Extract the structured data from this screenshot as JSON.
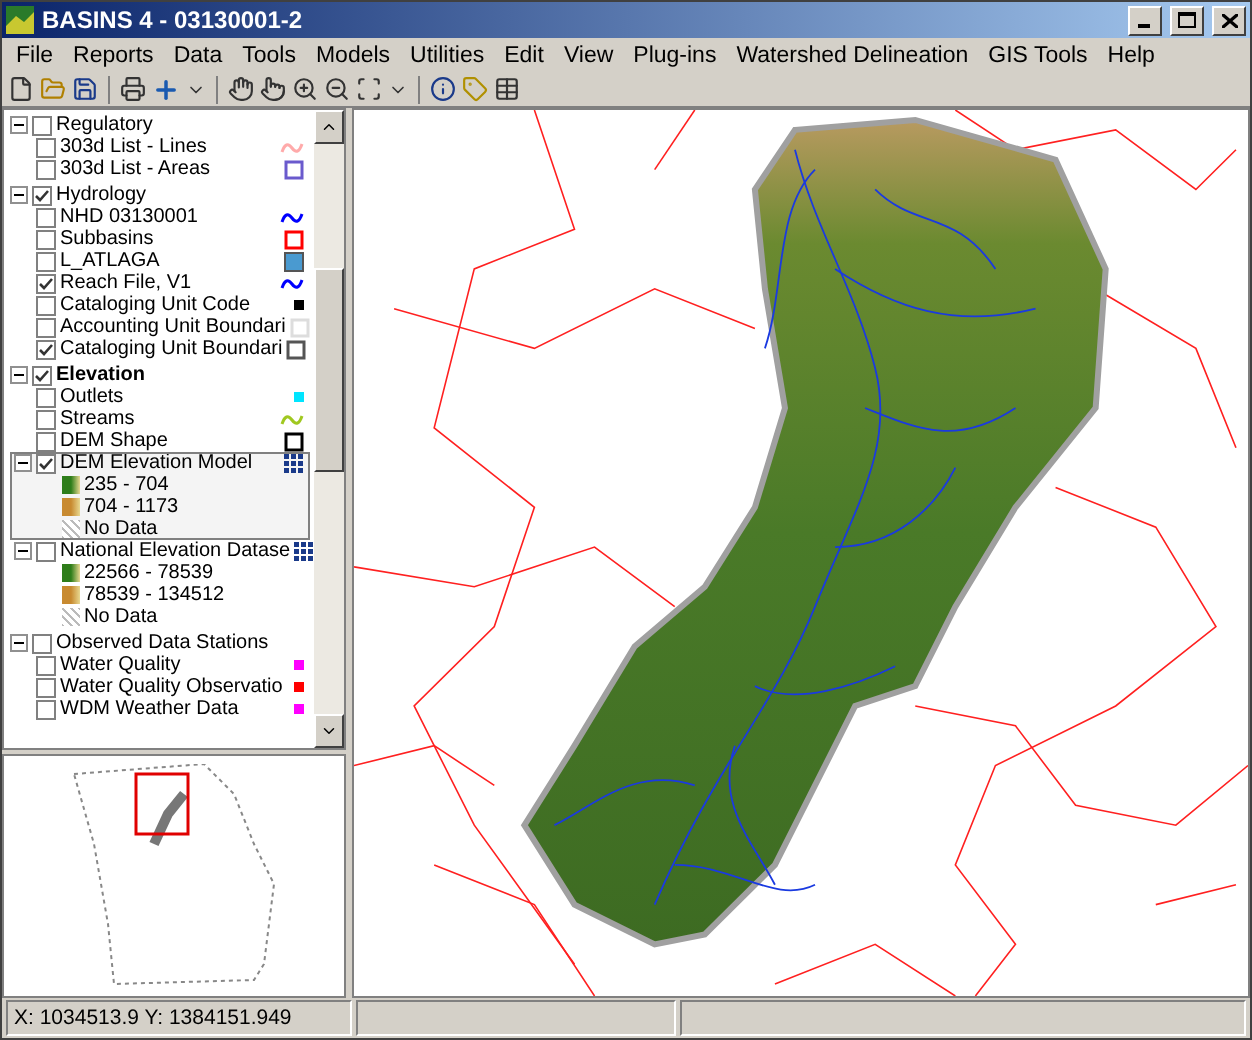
{
  "window": {
    "title": "BASINS 4 - 03130001-2"
  },
  "menu": [
    "File",
    "Reports",
    "Data",
    "Tools",
    "Models",
    "Utilities",
    "Edit",
    "View",
    "Plug-ins",
    "Watershed Delineation",
    "GIS Tools",
    "Help"
  ],
  "legend": {
    "groups": [
      {
        "name": "Regulatory",
        "checked": false,
        "expanded": true,
        "selected": false,
        "layers": [
          {
            "name": "303d List - Lines",
            "checked": false,
            "selected": false,
            "kind": "line",
            "color": "#ffaaaa"
          },
          {
            "name": "303d List - Areas",
            "checked": false,
            "selected": false,
            "kind": "outline",
            "color": "#6a5acd"
          }
        ]
      },
      {
        "name": "Hydrology",
        "checked": true,
        "expanded": true,
        "selected": false,
        "layers": [
          {
            "name": "NHD 03130001",
            "checked": false,
            "selected": false,
            "kind": "line",
            "color": "#0000ff"
          },
          {
            "name": "Subbasins",
            "checked": false,
            "selected": false,
            "kind": "outline",
            "color": "#ff0000"
          },
          {
            "name": "L_ATLAGA",
            "checked": false,
            "selected": false,
            "kind": "fill",
            "color": "#4a9ad0"
          },
          {
            "name": "Reach File, V1",
            "checked": true,
            "selected": false,
            "kind": "line",
            "color": "#0000ff"
          },
          {
            "name": "Cataloging Unit Code",
            "checked": false,
            "selected": false,
            "kind": "dot",
            "color": "#000000"
          },
          {
            "name": "Accounting  Unit Boundari",
            "checked": false,
            "selected": false,
            "kind": "outline",
            "color": "#dddddd"
          },
          {
            "name": "Cataloging  Unit Boundari",
            "checked": true,
            "selected": false,
            "kind": "outline",
            "color": "#555555"
          }
        ]
      },
      {
        "name": "Elevation",
        "checked": true,
        "expanded": true,
        "selected": true,
        "layers": [
          {
            "name": "Outlets",
            "checked": false,
            "selected": false,
            "kind": "dot",
            "color": "#00e5ff"
          },
          {
            "name": "Streams",
            "checked": false,
            "selected": false,
            "kind": "line",
            "color": "#a0c820"
          },
          {
            "name": "DEM Shape",
            "checked": false,
            "selected": false,
            "kind": "outline",
            "color": "#000000"
          },
          {
            "name": "DEM Elevation Model",
            "checked": true,
            "expanded": true,
            "selected": true,
            "kind": "grid",
            "color": "#1a3a8a",
            "entries": [
              {
                "label": "235 - 704",
                "kind": "ramp",
                "color": "#2e7d1a"
              },
              {
                "label": "704 - 1173",
                "kind": "ramp",
                "color": "#c88a30"
              },
              {
                "label": "No Data",
                "kind": "hatch",
                "color": "#bbbbbb"
              }
            ]
          },
          {
            "name": "National  Elevation Datase",
            "checked": false,
            "expanded": true,
            "selected": false,
            "kind": "grid",
            "color": "#1a3a8a",
            "entries": [
              {
                "label": "22566 - 78539",
                "kind": "ramp",
                "color": "#2e7d1a"
              },
              {
                "label": "78539 - 134512",
                "kind": "ramp",
                "color": "#c88a30"
              },
              {
                "label": "No Data",
                "kind": "hatch",
                "color": "#bbbbbb"
              }
            ]
          }
        ]
      },
      {
        "name": "Observed Data Stations",
        "checked": false,
        "expanded": true,
        "selected": false,
        "layers": [
          {
            "name": "Water Quality",
            "checked": false,
            "selected": false,
            "kind": "dot",
            "color": "#ff00ff"
          },
          {
            "name": "Water  Quality Observatio",
            "checked": false,
            "selected": false,
            "kind": "dot",
            "color": "#ff0000"
          },
          {
            "name": "WDM Weather Data",
            "checked": false,
            "selected": false,
            "kind": "dot",
            "color": "#ff00ff"
          }
        ]
      }
    ]
  },
  "status_bar": {
    "coordinates": "X: 1034513.9   Y: 1384151.949"
  }
}
